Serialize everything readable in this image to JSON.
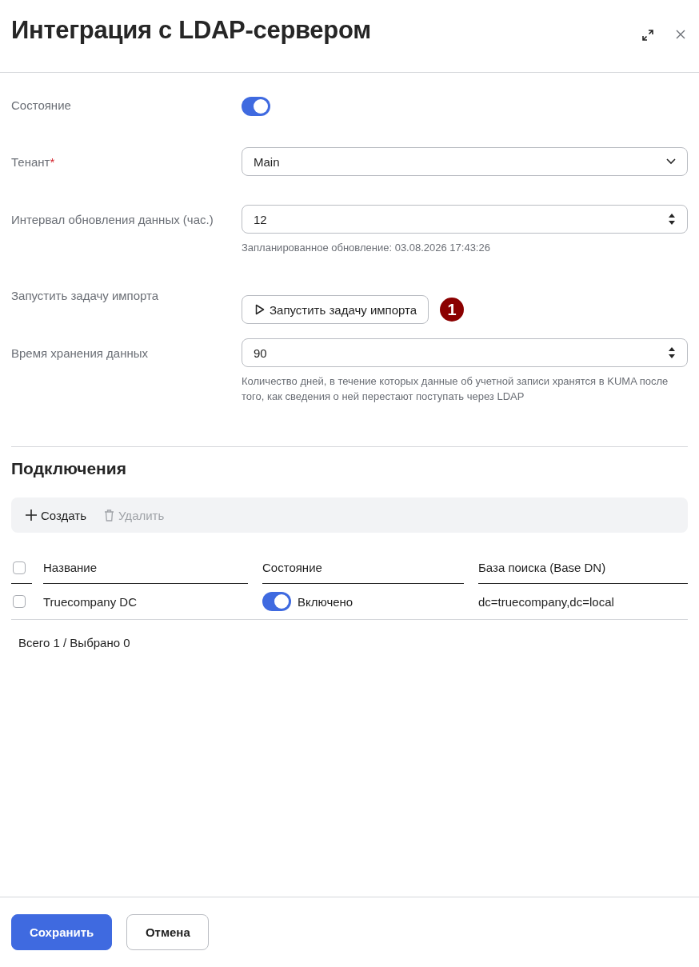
{
  "title": "Интеграция с LDAP-сервером",
  "fields": [
    {
      "kind": "toggle",
      "label": "Состояние",
      "on": true
    },
    {
      "kind": "select",
      "label": "Тенант",
      "required_mark": "*",
      "value": "Main"
    },
    {
      "kind": "number",
      "label": "Интервал обновления данных (час.)",
      "value": "12",
      "hint": "Запланированное обновление: 03.08.2026 17:43:26"
    },
    {
      "kind": "button",
      "label": "Запустить задачу импорта",
      "button": "Запустить задачу импорта",
      "callout": "1"
    },
    {
      "kind": "number",
      "label": "Время хранения данных",
      "value": "90",
      "hint": "Количество дней, в течение которых данные об учетной записи хранятся в KUMA после того, как сведения о ней перестают поступать через LDAP"
    }
  ],
  "connections": {
    "title": "Подключения",
    "toolbar": [
      {
        "kind": "create",
        "label": "Создать",
        "disabled": false
      },
      {
        "kind": "delete",
        "label": "Удалить",
        "disabled": true
      }
    ],
    "select_all": {
      "checked": false
    },
    "columns": [
      "Название",
      "Состояние",
      "База поиска (Base DN)"
    ],
    "rows": [
      {
        "checked": false,
        "name": "Truecompany DC",
        "on": true,
        "state": "Включено",
        "base_dn": "dc=truecompany,dc=local"
      }
    ],
    "summary": "Всего 1 / Выбрано 0"
  },
  "footer": [
    {
      "kind": "primary",
      "label": "Сохранить"
    },
    {
      "kind": "secondary",
      "label": "Отмена"
    }
  ]
}
